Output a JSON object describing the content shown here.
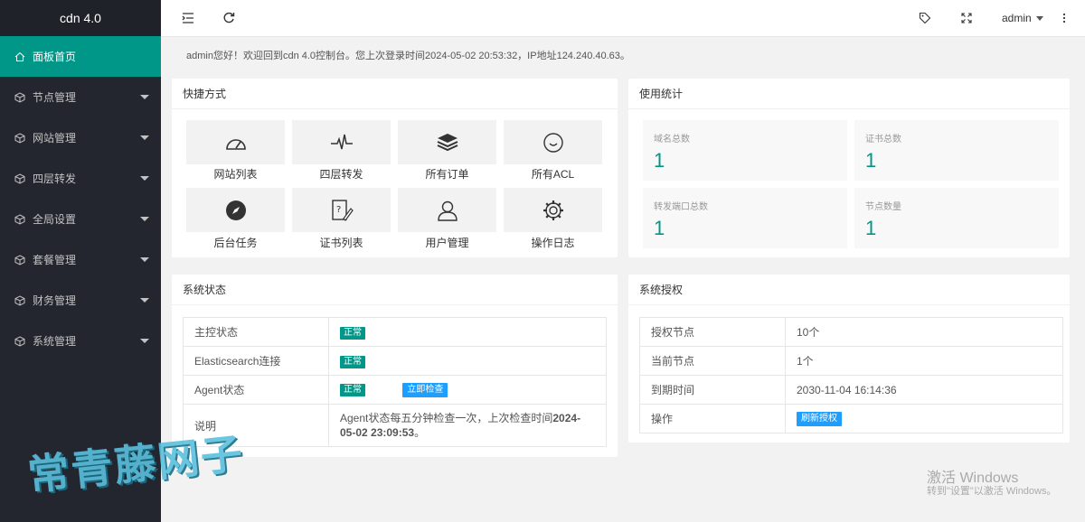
{
  "sidebar": {
    "logo": "cdn 4.0",
    "items": [
      {
        "label": "面板首页",
        "icon": "home-icon"
      },
      {
        "label": "节点管理",
        "icon": "cube-icon"
      },
      {
        "label": "网站管理",
        "icon": "cube-icon"
      },
      {
        "label": "四层转发",
        "icon": "cube-icon"
      },
      {
        "label": "全局设置",
        "icon": "cube-icon"
      },
      {
        "label": "套餐管理",
        "icon": "cube-icon"
      },
      {
        "label": "财务管理",
        "icon": "cube-icon"
      },
      {
        "label": "系统管理",
        "icon": "cube-icon"
      }
    ]
  },
  "header": {
    "user": "admin"
  },
  "welcome": "admin您好！欢迎回到cdn 4.0控制台。您上次登录时间2024-05-02 20:53:32，IP地址124.240.40.63。",
  "shortcuts": {
    "title": "快捷方式",
    "items": [
      {
        "label": "网站列表",
        "icon": "dashboard-gauge-icon"
      },
      {
        "label": "四层转发",
        "icon": "pulse-icon"
      },
      {
        "label": "所有订单",
        "icon": "layers-icon"
      },
      {
        "label": "所有ACL",
        "icon": "face-icon"
      },
      {
        "label": "后台任务",
        "icon": "compass-icon"
      },
      {
        "label": "证书列表",
        "icon": "certificate-edit-icon"
      },
      {
        "label": "用户管理",
        "icon": "user-icon"
      },
      {
        "label": "操作日志",
        "icon": "gear-icon"
      }
    ]
  },
  "stats": {
    "title": "使用统计",
    "items": [
      {
        "label": "域名总数",
        "value": "1"
      },
      {
        "label": "证书总数",
        "value": "1"
      },
      {
        "label": "转发端口总数",
        "value": "1"
      },
      {
        "label": "节点数量",
        "value": "1"
      }
    ]
  },
  "system_status": {
    "title": "系统状态",
    "rows": [
      {
        "label": "主控状态",
        "value": "正常"
      },
      {
        "label": "Elasticsearch连接",
        "value": "正常"
      },
      {
        "label": "Agent状态",
        "value": "正常",
        "action": "立即检查"
      },
      {
        "label": "说明",
        "desc_prefix": "Agent状态每五分钟检查一次，上次检查时间",
        "desc_time": "2024-05-02 23:09:53",
        "desc_suffix": "。"
      }
    ]
  },
  "license": {
    "title": "系统授权",
    "rows": [
      {
        "label": "授权节点",
        "value": "10个"
      },
      {
        "label": "当前节点",
        "value": "1个"
      },
      {
        "label": "到期时间",
        "value": "2030-11-04 16:14:36"
      },
      {
        "label": "操作",
        "action": "刷新授权"
      }
    ]
  },
  "overlay": {
    "watermark": "常青藤网子",
    "windows_line1": "激活 Windows",
    "windows_line2": "转到\"设置\"以激活 Windows。"
  },
  "colors": {
    "sidebar_bg": "#23262e",
    "accent": "#009688",
    "button_blue": "#1e9fff"
  }
}
